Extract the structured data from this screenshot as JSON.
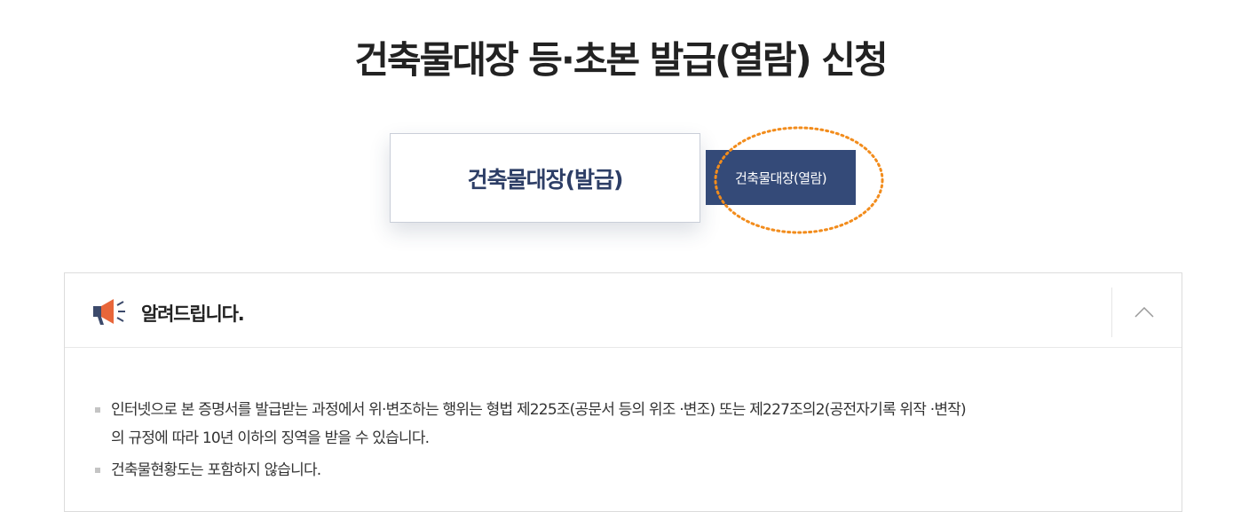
{
  "page": {
    "title": "건축물대장 등·초본 발급(열람) 신청"
  },
  "tabs": {
    "issue_label": "건축물대장(발급)",
    "view_label": "건축물대장(열람)"
  },
  "notice": {
    "title": "알려드립니다.",
    "items": [
      {
        "line1": "인터넷으로 본 증명서를 발급받는 과정에서 위·변조하는 행위는 형법 제225조(공문서 등의 위조 ·변조) 또는 제227조의2(공전자기록 위작 ·변작)",
        "line2": "의 규정에 따라 10년 이하의 징역을 받을 수 있습니다."
      },
      {
        "line1": "건축물현황도는 포함하지 않습니다."
      }
    ]
  },
  "icons": {
    "megaphone": "megaphone-icon",
    "collapse": "chevron-up-icon"
  },
  "colors": {
    "accent": "#344a78",
    "highlight": "#f28c1c",
    "megaphone": "#e8663a"
  }
}
